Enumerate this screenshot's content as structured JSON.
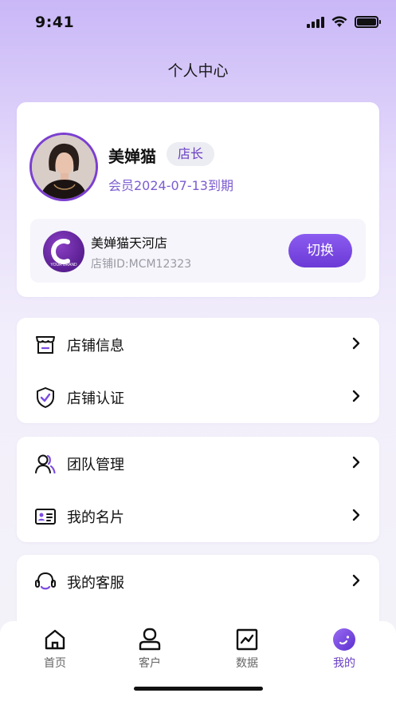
{
  "status_bar": {
    "time": "9:41"
  },
  "page_title": "个人中心",
  "profile": {
    "name": "美婵猫",
    "role": "店长",
    "membership": "会员2024-07-13到期"
  },
  "store": {
    "name": "美婵猫天河店",
    "id_text": "店铺ID:MCM12323",
    "switch_label": "切换",
    "logo_letter": "C",
    "logo_text": "YOUR BRAND"
  },
  "menu_groups": [
    {
      "items": [
        {
          "label": "店铺信息",
          "icon": "store-icon"
        },
        {
          "label": "店铺认证",
          "icon": "shield-check-icon"
        }
      ]
    },
    {
      "items": [
        {
          "label": "团队管理",
          "icon": "team-icon"
        },
        {
          "label": "我的名片",
          "icon": "id-card-icon"
        }
      ]
    },
    {
      "items": [
        {
          "label": "我的客服",
          "icon": "headset-icon"
        }
      ]
    }
  ],
  "tab_bar": {
    "tabs": [
      {
        "label": "首页",
        "icon": "home-icon"
      },
      {
        "label": "客户",
        "icon": "customer-icon"
      },
      {
        "label": "数据",
        "icon": "chart-icon"
      },
      {
        "label": "我的",
        "icon": "profile-icon",
        "active": true
      }
    ]
  },
  "colors": {
    "accent": "#6a3fc4",
    "button": "#7b4be0"
  }
}
